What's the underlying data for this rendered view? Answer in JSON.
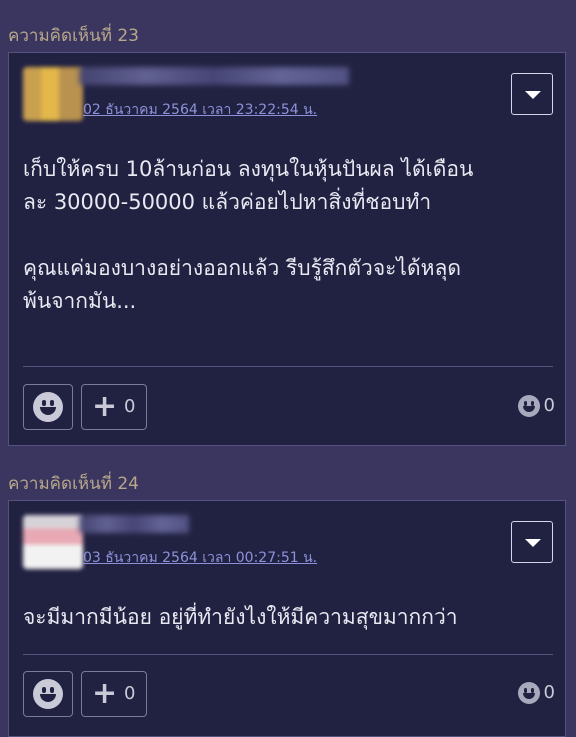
{
  "comments": [
    {
      "section_label": "ความคิดเห็นที่ 23",
      "timestamp": "02 ธันวาคม 2564 เวลา 23:22:54 น.",
      "body": "เก็บให้ครบ 10ล้านก่อน ลงทุนในหุ้นปันผล ได้เดือน\nละ 30000-50000 แล้วค่อยไปหาสิ่งที่ชอบทำ\n\nคุณแค่มองบางอย่างออกแล้ว รีบรู้สึกตัวจะได้หลุด\nพ้นจากมัน...",
      "plus_count": "0",
      "emote_count": "0"
    },
    {
      "section_label": "ความคิดเห็นที่ 24",
      "timestamp": "03 ธันวาคม 2564 เวลา 00:27:51 น.",
      "body": "จะมีมากมีน้อย อยู่ที่ทำยังไงให้มีความสุขมากกว่า",
      "plus_count": "0",
      "emote_count": "0"
    }
  ],
  "icons": {
    "dropdown": "chevron-down-icon",
    "react": "smiley-icon",
    "plus": "plus-icon"
  },
  "colors": {
    "background": "#3a3660",
    "card": "#212142",
    "border": "#56527e",
    "label": "#b8a88a",
    "timestamp": "#8d92d8"
  }
}
